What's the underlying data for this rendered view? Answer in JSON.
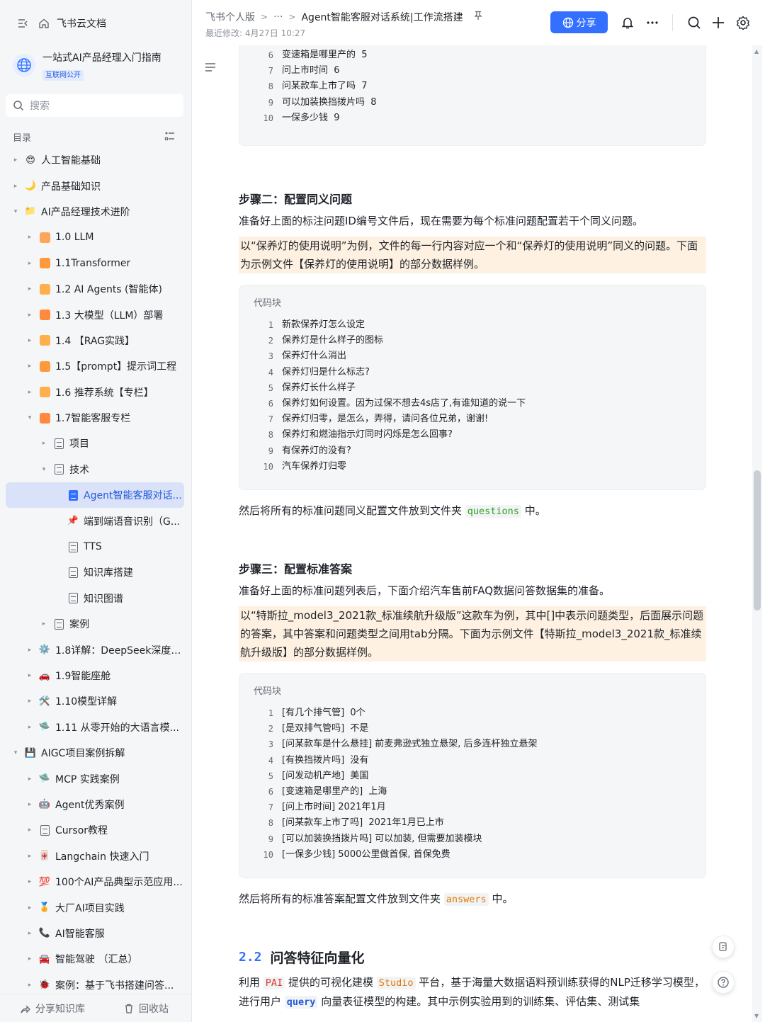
{
  "sidebar": {
    "brand": "飞书云文档",
    "space_name": "一站式AI产品经理入门指南",
    "space_badge": "互联网公开",
    "search_placeholder": "搜索",
    "toc_label": "目录",
    "items": [
      {
        "label": "人工智能基础",
        "level": 0,
        "arrow": "right",
        "emoji": "😍"
      },
      {
        "label": "产品基础知识",
        "level": 0,
        "arrow": "right",
        "emoji": "🌙"
      },
      {
        "label": "AI产品经理技术进阶",
        "level": 0,
        "arrow": "down",
        "emoji": "📁"
      },
      {
        "label": "1.0 LLM",
        "level": 1,
        "arrow": "right",
        "emoji": "orange-square"
      },
      {
        "label": "1.1Transformer",
        "level": 1,
        "arrow": "right",
        "emoji": "orange-square"
      },
      {
        "label": "1.2 AI Agents (智能体)",
        "level": 1,
        "arrow": "right",
        "emoji": "orange-square"
      },
      {
        "label": "1.3 大模型（LLM）部署",
        "level": 1,
        "arrow": "right",
        "emoji": "orange-square"
      },
      {
        "label": "1.4 【RAG实践】",
        "level": 1,
        "arrow": "right",
        "emoji": "orange-square"
      },
      {
        "label": "1.5【prompt】提示词工程",
        "level": 1,
        "arrow": "right",
        "emoji": "orange-square"
      },
      {
        "label": "1.6 推荐系统【专栏】",
        "level": 1,
        "arrow": "right",
        "emoji": "orange-square"
      },
      {
        "label": "1.7智能客服专栏",
        "level": 1,
        "arrow": "down",
        "emoji": "orange-square"
      },
      {
        "label": "项目",
        "level": 2,
        "arrow": "right",
        "emoji": "doc"
      },
      {
        "label": "技术",
        "level": 2,
        "arrow": "down",
        "emoji": "doc"
      },
      {
        "label": "Agent智能客服对话...",
        "level": 3,
        "arrow": "",
        "emoji": "doc-blue",
        "active": true
      },
      {
        "label": "端到端语音识别（G...",
        "level": 3,
        "arrow": "",
        "emoji": "📌"
      },
      {
        "label": "TTS",
        "level": 3,
        "arrow": "",
        "emoji": "doc"
      },
      {
        "label": "知识库搭建",
        "level": 3,
        "arrow": "",
        "emoji": "doc"
      },
      {
        "label": "知识图谱",
        "level": 3,
        "arrow": "",
        "emoji": "doc"
      },
      {
        "label": "案例",
        "level": 2,
        "arrow": "right",
        "emoji": "doc"
      },
      {
        "label": "1.8详解：DeepSeek深度推...",
        "level": 1,
        "arrow": "right",
        "emoji": "⚙️"
      },
      {
        "label": "1.9智能座舱",
        "level": 1,
        "arrow": "right",
        "emoji": "🚗"
      },
      {
        "label": "1.10模型详解",
        "level": 1,
        "arrow": "right",
        "emoji": "🛠️"
      },
      {
        "label": "1.11 从零开始的大语言模...",
        "level": 1,
        "arrow": "right",
        "emoji": "🛸"
      },
      {
        "label": "AIGC项目案例拆解",
        "level": 0,
        "arrow": "down",
        "emoji": "💾"
      },
      {
        "label": "MCP 实践案例",
        "level": 1,
        "arrow": "right",
        "emoji": "🛸"
      },
      {
        "label": "Agent优秀案例",
        "level": 1,
        "arrow": "right",
        "emoji": "🤖"
      },
      {
        "label": "Cursor教程",
        "level": 1,
        "arrow": "right",
        "emoji": "doc"
      },
      {
        "label": "Langchain 快速入门",
        "level": 1,
        "arrow": "right",
        "emoji": "🀄"
      },
      {
        "label": "100个AI产品典型示范应用...",
        "level": 1,
        "arrow": "right",
        "emoji": "💯"
      },
      {
        "label": "大厂AI项目实践",
        "level": 1,
        "arrow": "right",
        "emoji": "🏅"
      },
      {
        "label": "AI智能客服",
        "level": 1,
        "arrow": "right",
        "emoji": "📞"
      },
      {
        "label": "智能驾驶 （汇总）",
        "level": 1,
        "arrow": "right",
        "emoji": "🚘"
      },
      {
        "label": "案例：基于飞书搭建问答...",
        "level": 1,
        "arrow": "right",
        "emoji": "🐞"
      }
    ],
    "share_kb": "分享知识库",
    "recycle": "回收站"
  },
  "header": {
    "crumb_root": "飞书个人版",
    "crumb_more": "···",
    "crumb_current": "Agent智能客服对话系统|工作流搭建",
    "updated": "最近修改: 4月27日 10:27",
    "share_label": "分享"
  },
  "content": {
    "code0_lines": [
      {
        "n": "6",
        "t": "变速箱是哪里产的  5"
      },
      {
        "n": "7",
        "t": "问上市时间  6"
      },
      {
        "n": "8",
        "t": "问某款车上市了吗  7"
      },
      {
        "n": "9",
        "t": "可以加装换挡拨片吗  8"
      },
      {
        "n": "10",
        "t": "一保多少钱  9"
      }
    ],
    "step2_title": "步骤二：配置同义问题",
    "step2_p": "准备好上面的标注问题ID编号文件后，现在需要为每个标准问题配置若干个同义问题。",
    "step2_hl": "以“保养灯的使用说明”为例，文件的每一行内容对应一个和“保养灯的使用说明”同义的问题。下面为示例文件【保养灯的使用说明】的部分数据样例。",
    "code_label": "代码块",
    "code1_lines": [
      {
        "n": "1",
        "t": "新款保养灯怎么设定"
      },
      {
        "n": "2",
        "t": "保养灯是什么样子的图标"
      },
      {
        "n": "3",
        "t": "保养灯什么消出"
      },
      {
        "n": "4",
        "t": "保养灯归是什么标志?"
      },
      {
        "n": "5",
        "t": "保养灯长什么样子"
      },
      {
        "n": "6",
        "t": "保养灯如何设置。因为过保不想去4s店了,有谁知道的说一下"
      },
      {
        "n": "7",
        "t": "保养灯归零，是怎么，弄得，请问各位兄弟，谢谢!"
      },
      {
        "n": "8",
        "t": "保养灯和燃油指示灯同时闪烁是怎么回事?"
      },
      {
        "n": "9",
        "t": "有保养灯的没有?"
      },
      {
        "n": "10",
        "t": "汽车保养灯归零"
      }
    ],
    "after1_pre": "然后将所有的标准问题同义配置文件放到文件夹 ",
    "after1_code": "questions",
    "after1_post": " 中。",
    "step3_title": "步骤三：配置标准答案",
    "step3_p": "准备好上面的标准问题列表后，下面介绍汽车售前FAQ数据问答数据集的准备。",
    "step3_hl": "以“特斯拉_model3_2021款_标准续航升级版”这款车为例，其中[]中表示问题类型，后面展示问题的答案，其中答案和问题类型之间用tab分隔。下面为示例文件【特斯拉_model3_2021款_标准续航升级版】的部分数据样例。",
    "code2_lines": [
      {
        "n": "1",
        "t": "[有几个排气管]  0个"
      },
      {
        "n": "2",
        "t": "[是双排气管吗]  不是"
      },
      {
        "n": "3",
        "t": "[问某款车是什么悬挂] 前麦弗逊式独立悬架, 后多连杆独立悬架"
      },
      {
        "n": "4",
        "t": "[有换挡拨片吗]  没有"
      },
      {
        "n": "5",
        "t": "[问发动机产地]  美国"
      },
      {
        "n": "6",
        "t": "[变速箱是哪里产的]  上海"
      },
      {
        "n": "7",
        "t": "[问上市时间] 2021年1月"
      },
      {
        "n": "8",
        "t": "[问某款车上市了吗]  2021年1月已上市"
      },
      {
        "n": "9",
        "t": "[可以加装换挡拨片吗] 可以加装, 但需要加装模块"
      },
      {
        "n": "10",
        "t": "[一保多少钱] 5000公里做首保, 首保免费"
      }
    ],
    "after2_pre": "然后将所有的标准答案配置文件放到文件夹 ",
    "after2_code": "answers",
    "after2_post": " 中。",
    "h2_num": "2.2",
    "h2_title": "问答特征向量化",
    "last_p1": "利用 ",
    "last_c1": "PAI",
    "last_p2": " 提供的可视化建模 ",
    "last_c2": "Studio",
    "last_p3": " 平台，基于海量大数据语料预训练获得的NLP迁移学习模型，进行用户 ",
    "last_c3": "query",
    "last_p4": " 向量表征模型的构建。其中示例实验用到的训练集、评估集、测试集"
  }
}
